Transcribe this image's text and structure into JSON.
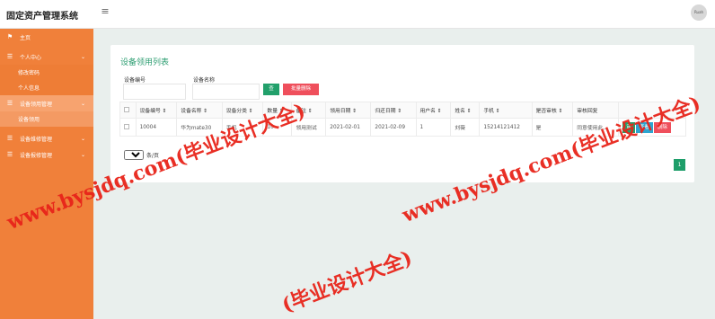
{
  "app": {
    "title": "固定资产管理系统",
    "avatar_text": "Ruah"
  },
  "sidebar": {
    "items": [
      {
        "label": "主页",
        "icon": "flag-icon"
      },
      {
        "label": "个人中心",
        "icon": "list-icon",
        "children": [
          "修改密码",
          "个人信息"
        ]
      },
      {
        "label": "设备领用管理",
        "icon": "list-icon",
        "children": [
          "设备领用"
        ]
      },
      {
        "label": "设备维修管理",
        "icon": "list-icon"
      },
      {
        "label": "设备报修管理",
        "icon": "list-icon"
      }
    ]
  },
  "page": {
    "title": "设备领用列表",
    "filters": [
      {
        "label": "设备编号",
        "value": ""
      },
      {
        "label": "设备名称",
        "value": ""
      }
    ],
    "search_label": "查",
    "batch_delete_label": "批量删除"
  },
  "table": {
    "columns": [
      "设备编号 ⇕",
      "设备名称 ⇕",
      "设备分类 ⇕",
      "数量 ⇕",
      "备注 ⇕",
      "领用日期 ⇕",
      "归还日期 ⇕",
      "用户名 ⇕",
      "姓名 ⇕",
      "手机 ⇕",
      "是否审核 ⇕",
      "审核回复",
      ""
    ],
    "rows": [
      {
        "cells": [
          "10004",
          "华为mate30",
          "手机",
          "10",
          "领用测试",
          "2021-02-01",
          "2021-02-09",
          "1",
          "刘薇",
          "15214121412",
          "是",
          "同意使用此..."
        ],
        "actions": [
          "审",
          "查看",
          "删除"
        ]
      }
    ]
  },
  "pagination": {
    "page_size": "10",
    "page_size_suffix": "条/页",
    "current_page": "1"
  },
  "watermarks": [
    "www.bysjdq.com(毕业设计大全)",
    "www.bysjdq.com(毕业设计大全)",
    "(毕业设计大全)"
  ],
  "colors": {
    "sidebar": "#f0803a",
    "accent": "#22a06b",
    "danger": "#ef4f5c",
    "info": "#2ca5d0",
    "watermark": "#e8241a"
  }
}
